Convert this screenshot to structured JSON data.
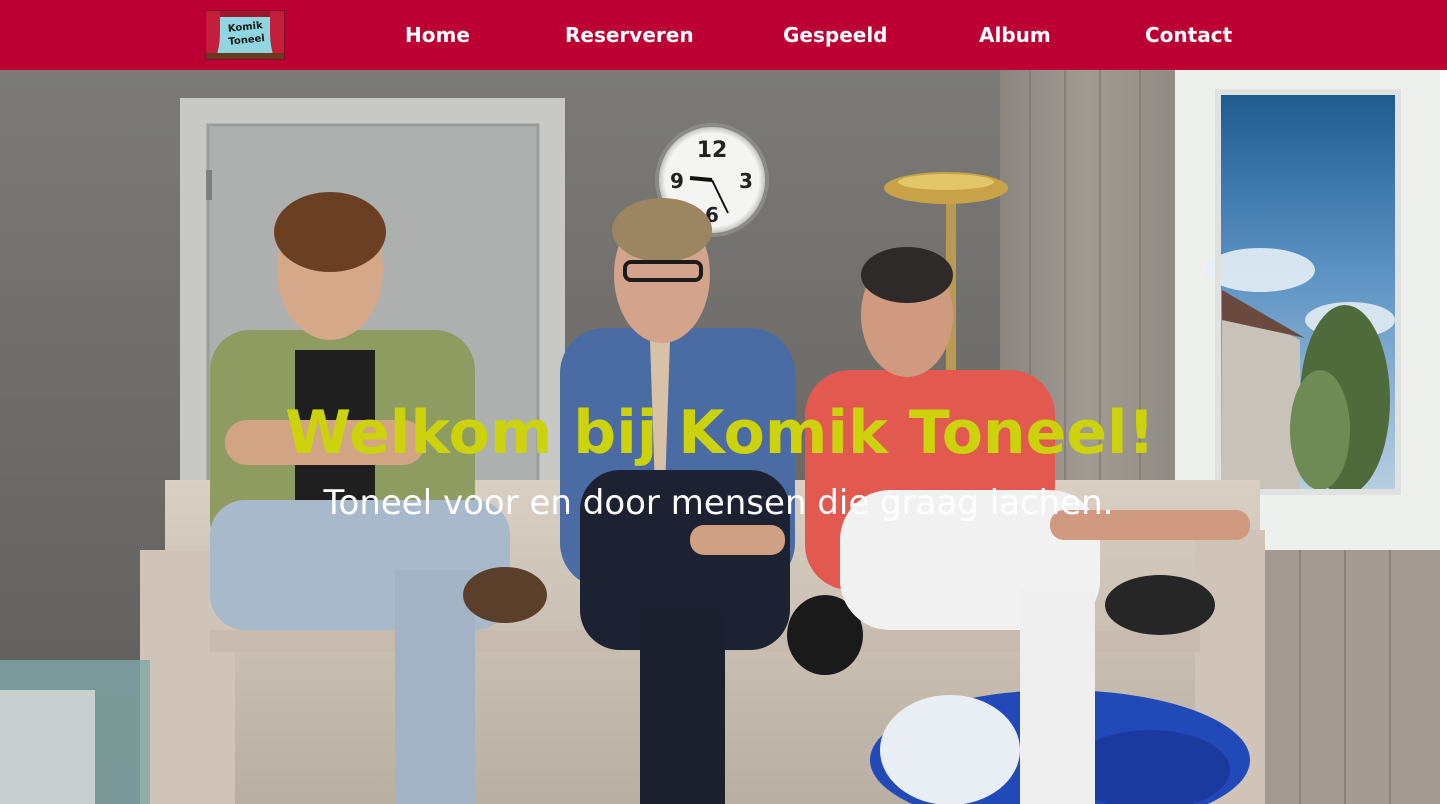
{
  "site": {
    "logo_text_line1": "Komik",
    "logo_text_line2": "Toneel"
  },
  "nav": {
    "items": [
      {
        "label": "Home"
      },
      {
        "label": "Reserveren"
      },
      {
        "label": "Gespeeld"
      },
      {
        "label": "Album"
      },
      {
        "label": "Contact"
      }
    ]
  },
  "hero": {
    "title": "Welkom bij Komik Toneel!",
    "subtitle": "Toneel voor en door mensen die graag lachen."
  },
  "colors": {
    "nav_background": "#bd0033",
    "title_color": "#ccd20b",
    "subtitle_color": "#ffffff"
  }
}
